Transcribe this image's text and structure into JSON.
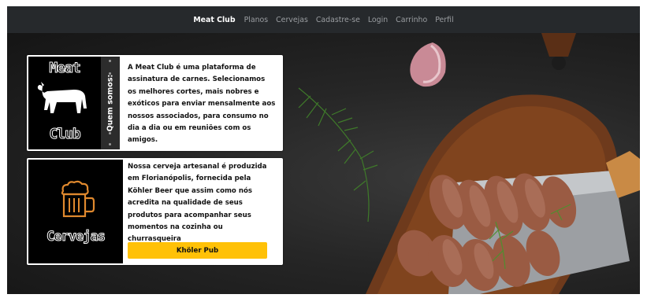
{
  "navbar": {
    "brand": "Meat Club",
    "links": [
      "Planos",
      "Cervejas",
      "Cadastre-se",
      "Login",
      "Carrinho",
      "Perfil"
    ]
  },
  "card_meat": {
    "logo_line1": "Meat",
    "logo_line2": "Club",
    "side_label": "Quem somos:",
    "text": "A Meat Club é uma plataforma de assinatura de carnes. Selecionamos os melhores cortes, mais nobres e exóticos para enviar mensalmente aos nossos associados, para consumo no dia a dia ou em reuniões com os amigos."
  },
  "card_beer": {
    "logo_text": "Cervejas",
    "text": "Nossa cerveja artesanal é produzida em Florianópolis, fornecida pela Köhler Beer que assim como nós acredita na qualidade de seus produtos para acompanhar seus momentos na cozinha ou churrasqueira",
    "button_label": "Khöler Pub"
  },
  "icons": {
    "cow": "cow-icon",
    "beer": "beer-mug-icon"
  },
  "colors": {
    "navbar_bg": "#26292c",
    "brand_text": "#ffffff",
    "nav_link": "#9a9da1",
    "button_bg": "#ffc107",
    "beer_icon": "#e0892e"
  }
}
